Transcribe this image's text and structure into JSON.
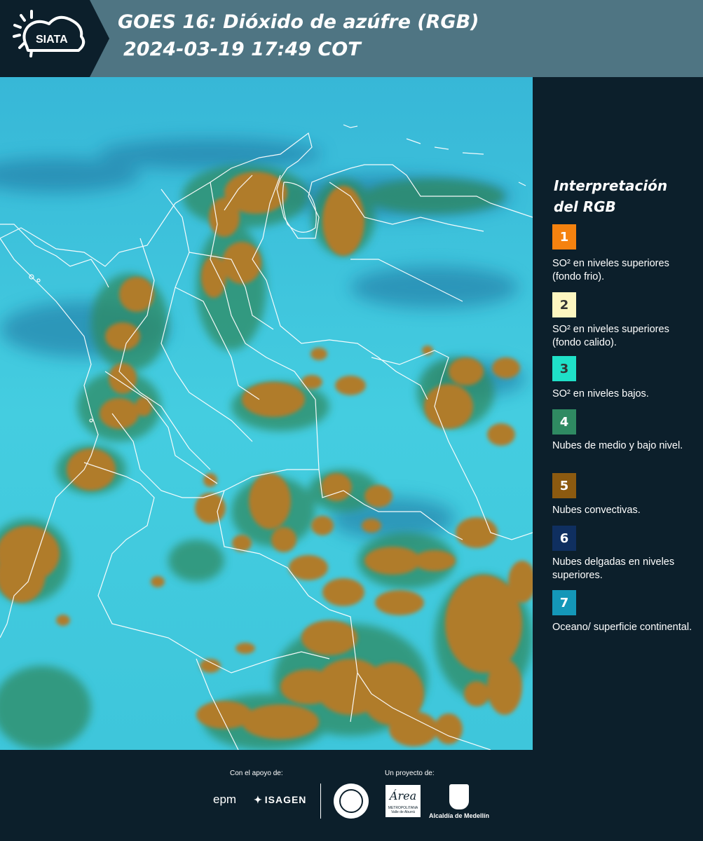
{
  "header": {
    "logo_text": "SIATA",
    "title_line1": "GOES 16: Dióxido de azúfre (RGB)",
    "title_line2": "2024-03-19 17:49 COT"
  },
  "legend": {
    "title": "Interpretación del RGB",
    "items": [
      {
        "number": "1",
        "label": "SO² en niveles superiores (fondo frio).",
        "color": "#f5820f",
        "text_color": "#ffffff"
      },
      {
        "number": "2",
        "label": "SO² en niveles superiores (fondo calido).",
        "color": "#fdf6c0",
        "text_color": "#333333"
      },
      {
        "number": "3",
        "label": "SO² en niveles bajos.",
        "color": "#1fe0c8",
        "text_color": "#333333"
      },
      {
        "number": "4",
        "label": "Nubes de medio y bajo nivel.",
        "color": "#2f8a62",
        "text_color": "#ffffff"
      },
      {
        "number": "5",
        "label": "Nubes convectivas.",
        "color": "#8c5a10",
        "text_color": "#ffffff"
      },
      {
        "number": "6",
        "label": "Nubes delgadas en niveles superiores.",
        "color": "#0f2f60",
        "text_color": "#ffffff"
      },
      {
        "number": "7",
        "label": "Oceano/ superficie continental.",
        "color": "#1497b8",
        "text_color": "#ffffff"
      }
    ]
  },
  "footer": {
    "support_label": "Con el apoyo de:",
    "project_label": "Un proyecto de:",
    "sponsor_epm": "epm",
    "sponsor_isagen": "ISAGEN",
    "area_name": "Área",
    "area_sub": "METROPOLITANA Valle de Aburrá",
    "medellin": "Alcaldía de Medellín"
  },
  "colors": {
    "header_bg": "#4f7583",
    "page_bg": "#0c1f2b",
    "ocean": "#3ac8dc",
    "cloud_convective": "#b07c2a",
    "cloud_mid": "#2f8a62"
  }
}
